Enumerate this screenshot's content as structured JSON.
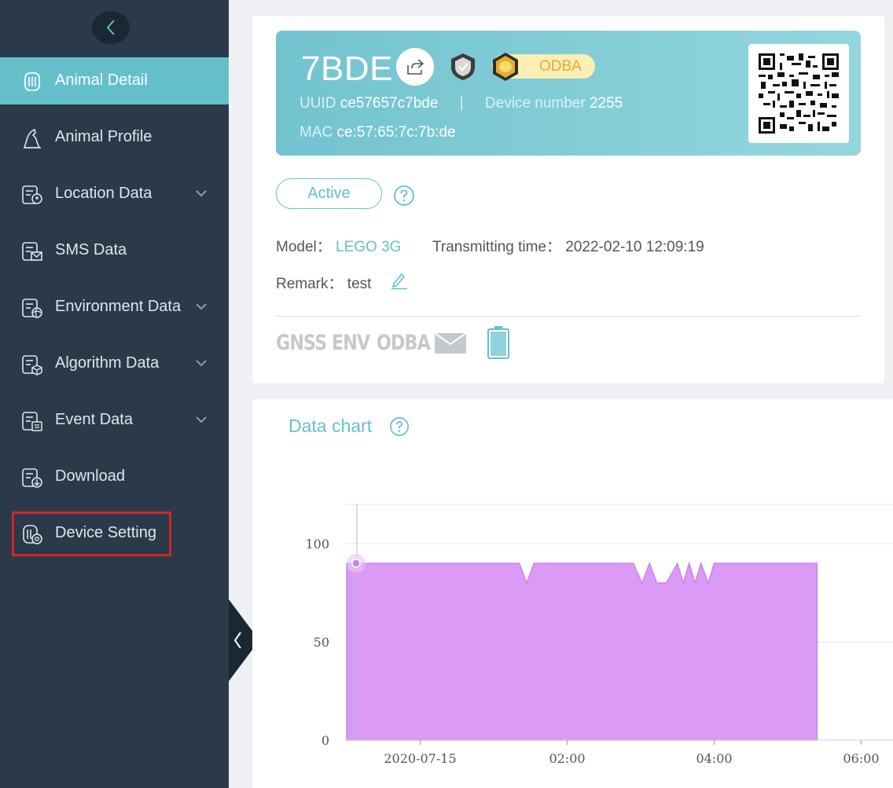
{
  "sidebar": {
    "items": [
      {
        "label": "Animal Detail",
        "icon": "animal-detail-icon",
        "active": true,
        "expandable": false
      },
      {
        "label": "Animal Profile",
        "icon": "animal-profile-icon",
        "active": false,
        "expandable": false
      },
      {
        "label": "Location Data",
        "icon": "location-data-icon",
        "active": false,
        "expandable": true
      },
      {
        "label": "SMS Data",
        "icon": "sms-data-icon",
        "active": false,
        "expandable": false
      },
      {
        "label": "Environment Data",
        "icon": "environment-data-icon",
        "active": false,
        "expandable": true
      },
      {
        "label": "Algorithm Data",
        "icon": "algorithm-data-icon",
        "active": false,
        "expandable": true
      },
      {
        "label": "Event Data",
        "icon": "event-data-icon",
        "active": false,
        "expandable": true
      },
      {
        "label": "Download",
        "icon": "download-icon",
        "active": false,
        "expandable": false
      },
      {
        "label": "Device Setting",
        "icon": "device-setting-icon",
        "active": false,
        "expandable": false,
        "highlighted": true
      }
    ]
  },
  "device": {
    "id": "7BDE",
    "odba_badge": "ODBA",
    "uuid_label": "UUID",
    "uuid": "ce57657c7bde",
    "separator": "|",
    "device_number_label": "Device number",
    "device_number": "2255",
    "mac_label": "MAC",
    "mac": "ce:57:65:7c:7b:de",
    "status": "Active",
    "model_label": "Model：",
    "model": "LEGO 3G",
    "transmitting_label": "Transmitting time：",
    "transmitting_time": "2022-02-10 12:09:19",
    "remark_label": "Remark：",
    "remark": "test",
    "features": [
      "GNSS",
      "ENV",
      "ODBA"
    ]
  },
  "colors": {
    "sidebar_bg": "#2b3a4a",
    "accent": "#64bfcb",
    "chart_fill": "#da9af5",
    "highlight_border": "#d4232b"
  },
  "chart": {
    "title": "Data chart"
  },
  "chart_data": {
    "type": "area",
    "title": "",
    "xlabel": "",
    "ylabel": "",
    "ylim": [
      0,
      120
    ],
    "yticks": [
      "0",
      "50",
      "100"
    ],
    "xticks": [
      "2020-07-15",
      "02:00",
      "04:00",
      "06:00"
    ],
    "grid": true,
    "series": [
      {
        "color": "#da9af5",
        "x": [
          0.0,
          0.15,
          0.5,
          2.35,
          2.45,
          2.55,
          3.9,
          4.02,
          4.12,
          4.22,
          4.35,
          4.5,
          4.58,
          4.66,
          4.74,
          4.82,
          4.92,
          5.0,
          5.1,
          6.4
        ],
        "values": [
          90,
          90,
          90,
          90,
          80,
          90,
          90,
          80,
          90,
          80,
          80,
          90,
          80,
          90,
          80,
          90,
          80,
          90,
          90,
          90
        ]
      }
    ]
  }
}
